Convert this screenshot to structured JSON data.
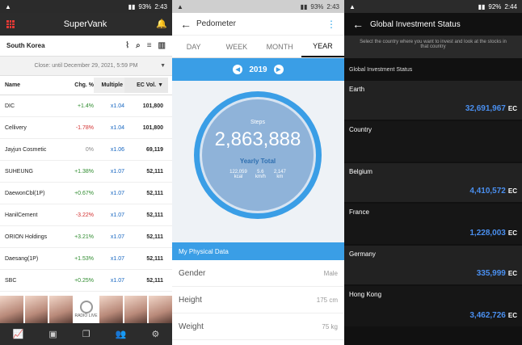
{
  "panel1": {
    "status_time": "2:43",
    "status_battery": "93%",
    "app_title": "SuperVank",
    "country": "South Korea",
    "close_label": "Close: until December 29, 2021, 5:59 PM",
    "columns": {
      "name": "Name",
      "chg": "Chg. %",
      "mul": "Multiple",
      "ec": "EC Vol."
    },
    "rows": [
      {
        "name": "DIC",
        "chg": "+1.4%",
        "mul": "x1.04",
        "ec": "101,800",
        "dir": "pos"
      },
      {
        "name": "Cellivery",
        "chg": "-1.78%",
        "mul": "x1.04",
        "ec": "101,800",
        "dir": "neg"
      },
      {
        "name": "Jayjun Cosmetic",
        "chg": "0%",
        "mul": "x1.06",
        "ec": "69,119",
        "dir": "zero"
      },
      {
        "name": "SUHEUNG",
        "chg": "+1.38%",
        "mul": "x1.07",
        "ec": "52,111",
        "dir": "pos"
      },
      {
        "name": "DaewonCbl(1P)",
        "chg": "+0.67%",
        "mul": "x1.07",
        "ec": "52,111",
        "dir": "pos"
      },
      {
        "name": "HanilCement",
        "chg": "-3.22%",
        "mul": "x1.07",
        "ec": "52,111",
        "dir": "neg"
      },
      {
        "name": "ORION Holdings",
        "chg": "+3.21%",
        "mul": "x1.07",
        "ec": "52,111",
        "dir": "pos"
      },
      {
        "name": "Daesang(1P)",
        "chg": "+1.53%",
        "mul": "x1.07",
        "ec": "52,111",
        "dir": "pos"
      },
      {
        "name": "SBC",
        "chg": "+0.25%",
        "mul": "x1.07",
        "ec": "52,111",
        "dir": "pos"
      }
    ],
    "logo_text": "RADIO LIVE"
  },
  "panel2": {
    "status_time": "2:43",
    "status_battery": "93%",
    "title": "Pedometer",
    "tabs": [
      "DAY",
      "WEEK",
      "MONTH",
      "YEAR"
    ],
    "year": "2019",
    "steps_label": "Steps",
    "steps_value": "2,863,888",
    "yearly_total": "Yearly Total",
    "stats": [
      {
        "value": "122,059",
        "unit": "kcal"
      },
      {
        "value": "5.6",
        "unit": "km/h"
      },
      {
        "value": "2,147",
        "unit": "km"
      }
    ],
    "section": "My Physical Data",
    "physical": [
      {
        "label": "Gender",
        "value": "Male"
      },
      {
        "label": "Height",
        "value": "175 cm"
      },
      {
        "label": "Weight",
        "value": "75 kg"
      }
    ]
  },
  "panel3": {
    "status_time": "2:44",
    "status_battery": "92%",
    "title": "Global Investment Status",
    "instruction": "Select the country where you want to invest and look at the stocks in that country",
    "section": "Global Investment Status",
    "rows": [
      {
        "name": "Earth",
        "amount": "32,691,967",
        "unit": "EC"
      },
      {
        "name": "Country",
        "amount": "",
        "unit": ""
      },
      {
        "name": "Belgium",
        "amount": "4,410,572",
        "unit": "EC"
      },
      {
        "name": "France",
        "amount": "1,228,003",
        "unit": "EC"
      },
      {
        "name": "Germany",
        "amount": "335,999",
        "unit": "EC"
      },
      {
        "name": "Hong Kong",
        "amount": "3,462,726",
        "unit": "EC"
      }
    ]
  }
}
